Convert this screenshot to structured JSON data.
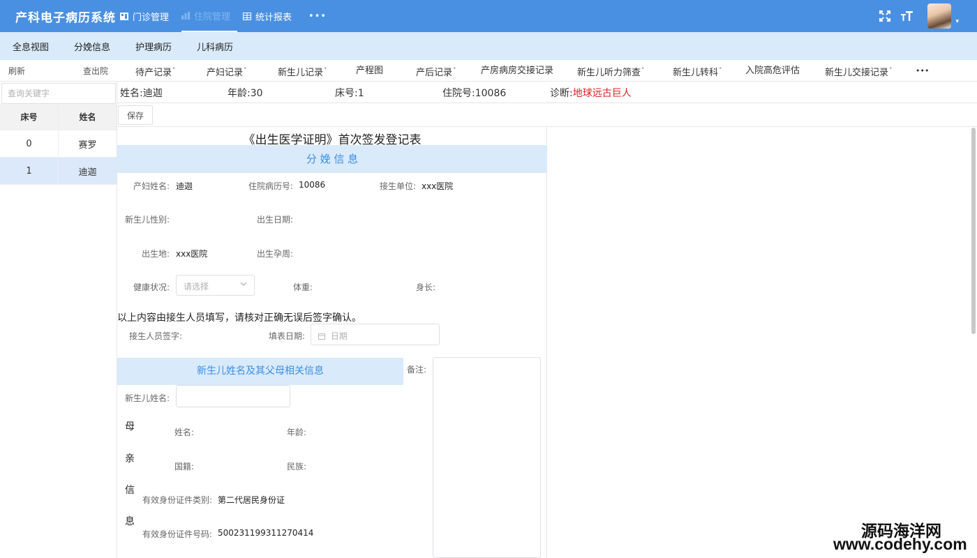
{
  "header": {
    "app_title": "产科电子病历系统",
    "nav": [
      {
        "label": "门诊管理",
        "icon": "home-icon"
      },
      {
        "label": "住院管理",
        "icon": "bar-chart-icon",
        "active": true
      },
      {
        "label": "统计报表",
        "icon": "grid-icon"
      }
    ],
    "more": "•••",
    "right_icons": [
      "fullscreen-icon",
      "font-size-icon"
    ],
    "avatar_caret": "▾"
  },
  "subnav": [
    "全息视图",
    "分娩信息",
    "护理病历",
    "儿科病历"
  ],
  "tabbar": {
    "left_actions": [
      "刷新",
      "查出院"
    ],
    "tabs": [
      {
        "label": "待产记录",
        "dropdown": true
      },
      {
        "label": "产妇记录",
        "dropdown": true
      },
      {
        "label": "新生儿记录",
        "dropdown": true
      },
      {
        "label": "产程图",
        "dropdown": false
      },
      {
        "label": "产后记录",
        "dropdown": true
      },
      {
        "label": "产房病房交接记录",
        "dropdown": false
      },
      {
        "label": "新生儿听力筛查",
        "dropdown": true
      },
      {
        "label": "新生儿转科",
        "dropdown": true
      },
      {
        "label": "入院高危评估",
        "dropdown": false
      },
      {
        "label": "新生儿交接记录",
        "dropdown": true
      }
    ],
    "more": "•••",
    "caret": "ˇ"
  },
  "left_panel": {
    "search_placeholder": "查询关键字",
    "columns": [
      "床号",
      "姓名"
    ],
    "rows": [
      {
        "bed": "0",
        "name": "赛罗"
      },
      {
        "bed": "1",
        "name": "迪迦"
      }
    ],
    "selected_index": 1
  },
  "patient": {
    "name_label": "姓名:",
    "name": "迪迦",
    "age_label": "年龄:",
    "age": "30",
    "bed_label": "床号:",
    "bed": "1",
    "admission_label": "住院号:",
    "admission_no": "10086",
    "diagnosis_label": "诊断:",
    "diagnosis": "地球远古巨人"
  },
  "toolbar": {
    "save": "保存"
  },
  "form": {
    "title": "《出生医学证明》首次签发登记表",
    "section1": "分 娩 信 息",
    "mother_name_label": "产妇姓名:",
    "mother_name": "迪迦",
    "record_no_label": "住院病历号:",
    "record_no": "10086",
    "delivery_unit_label": "接生单位:",
    "delivery_unit": "xxx医院",
    "baby_sex_label": "新生儿性别:",
    "birth_date_label": "出生日期:",
    "birth_place_label": "出生地:",
    "birth_place": "xxx医院",
    "gestation_label": "出生孕周:",
    "health_label": "健康状况:",
    "health_placeholder": "请选择",
    "weight_label": "体重:",
    "height_label": "身长:",
    "notice": "以上内容由接生人员填写，请核对正确无误后签字确认。",
    "midwife_sign_label": "接生人员签字:",
    "fill_date_label": "填表日期:",
    "fill_date_placeholder": "日期",
    "section2": "新生儿姓名及其父母相关信息",
    "remark_label": "备注:",
    "baby_name_label": "新生儿姓名:",
    "mother_vertical": [
      "母",
      "亲",
      "信",
      "息"
    ],
    "m_name_label": "姓名:",
    "m_age_label": "年龄:",
    "m_nationality_label": "国籍:",
    "m_ethnicity_label": "民族:",
    "m_id_type_label": "有效身份证件类别:",
    "m_id_type": "第二代居民身份证",
    "m_id_no_label": "有效身份证件号码:",
    "m_id_no": "500231199311270414"
  },
  "watermark": {
    "line1": "源码海洋网",
    "line2": "www.codehy.com"
  }
}
